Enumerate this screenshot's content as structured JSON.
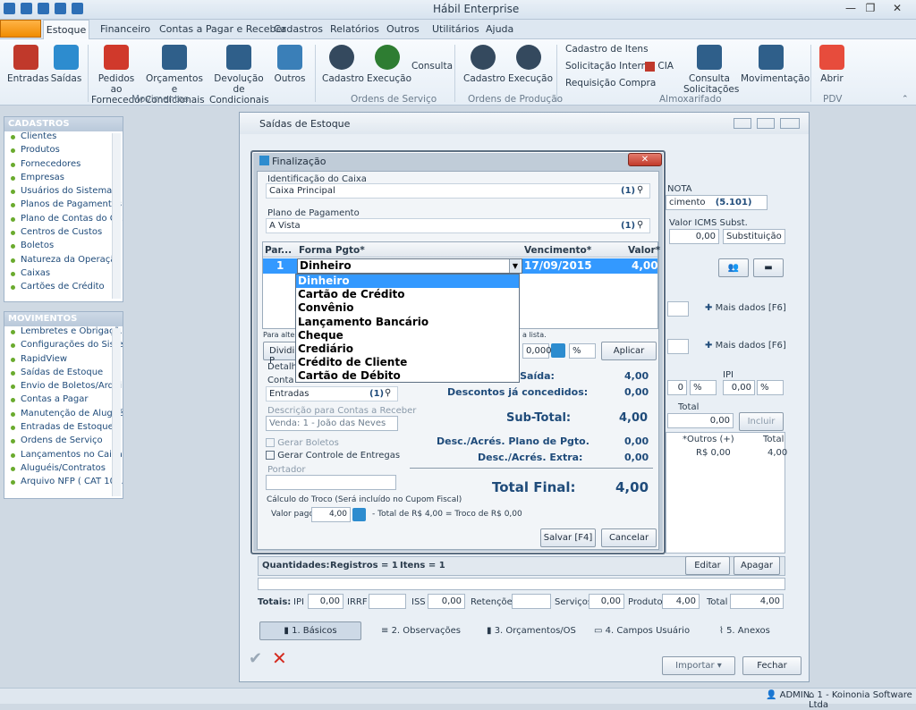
{
  "app": {
    "title": "Hábil Enterprise"
  },
  "menu": {
    "tabs": [
      "Estoque",
      "Financeiro",
      "Contas a Pagar e Receber",
      "Cadastros",
      "Relatórios",
      "Outros",
      "Utilitários",
      "Ajuda"
    ]
  },
  "ribbon": {
    "buttons": [
      {
        "label": "Entradas"
      },
      {
        "label": "Saídas"
      },
      {
        "label": "Pedidos ao\nFornecedor"
      },
      {
        "label": "Orçamentos e\nCondicionais"
      },
      {
        "label": "Devolução de\nCondicionais"
      },
      {
        "label": "Outros"
      },
      {
        "label": "Cadastro"
      },
      {
        "label": "Execução"
      },
      {
        "label": "Consulta"
      },
      {
        "label": "Cadastro"
      },
      {
        "label": "Execução"
      },
      {
        "label": "Cadastro de Itens"
      },
      {
        "label": "Solicitação Interna"
      },
      {
        "label": "Requisição Compra"
      },
      {
        "label": "CIA"
      },
      {
        "label": "Consulta\nSolicitações"
      },
      {
        "label": "Movimentação"
      },
      {
        "label": "Abrir"
      }
    ],
    "groups": [
      "Movimentos",
      "Ordens de Serviço",
      "Ordens de Produção",
      "Almoxarifado",
      "PDV"
    ]
  },
  "sidebar": {
    "cadastros_title": "CADASTROS",
    "cadastros": [
      "Clientes",
      "Produtos",
      "Fornecedores",
      "Empresas",
      "Usuários do Sistema",
      "Planos de Pagamentos",
      "Plano de Contas do Ca...",
      "Centros de Custos",
      "Boletos",
      "Natureza da Operação",
      "Caixas",
      "Cartões de Crédito"
    ],
    "movimentos_title": "MOVIMENTOS",
    "movimentos": [
      "Lembretes e Obrigaçõ...",
      "Configurações do Siste...",
      "RapidView",
      "Saídas de Estoque",
      "Envio de Boletos/Arqui...",
      "Contas a Pagar",
      "Manutenção de Alugué...",
      "Entradas de Estoque",
      "Ordens de Serviço",
      "Lançamentos no Caixa",
      "Aluguéis/Contratos",
      "Arquivo NFP ( CAT 102..."
    ]
  },
  "saidas": {
    "title": "Saídas de Estoque",
    "nota_label": "NOTA",
    "natureza_value": "cimento",
    "natureza_code": "(5.101)",
    "icms_label": "Valor ICMS Subst.",
    "icms_value": "0,00",
    "subst_select": "Substituição",
    "mais_dados": "Mais dados [F6]",
    "ipi_label": "IPI",
    "ipi_value": "0,00",
    "pct": "%",
    "disc_value": "0",
    "total_label": "Total",
    "total_value": "0,00",
    "incluir": "Incluir",
    "outros_col": "*Outros (+)",
    "total_col": "Total",
    "row_outros": "R$ 0,00",
    "row_total": "4,00",
    "quantidades": "Quantidades:",
    "registros": "Registros = 1",
    "itens": "Itens = 1",
    "editar": "Editar",
    "apagar": "Apagar",
    "totais": {
      "label": "Totais:",
      "ipi_label": "IPI",
      "ipi": "0,00",
      "irrf_label": "IRRF",
      "iss_label": "ISS",
      "iss": "0,00",
      "ret_label": "Retenções",
      "serv_label": "Serviços",
      "serv": "0,00",
      "prod_label": "Produtos",
      "prod": "4,00",
      "total_label": "Total",
      "total": "4,00"
    },
    "tabs": [
      "1. Básicos",
      "2. Observações",
      "3. Orçamentos/OS",
      "4. Campos Usuário",
      "5. Anexos"
    ],
    "importar": "Importar",
    "fechar": "Fechar"
  },
  "dialog": {
    "title": "Finalização",
    "caixa_label": "Identificação do Caixa",
    "caixa_value": "Caixa Principal",
    "caixa_code": "(1)",
    "plano_label": "Plano de Pagamento",
    "plano_value": "A Vista",
    "plano_code": "(1)",
    "grid_headers": [
      "Par...",
      "Forma Pgto*",
      "Vencimento*",
      "Valor*"
    ],
    "grid_row": {
      "par": "1",
      "forma": "Dinheiro",
      "venc": "17/09/2015",
      "valor": "4,00"
    },
    "dropdown": [
      "Dinheiro",
      "Cartão de Crédito",
      "Convênio",
      "Lançamento Bancário",
      "Cheque",
      "Crediário",
      "Crédito de Cliente",
      "Cartão de Débito"
    ],
    "hint_left": "Para alterar",
    "hint_right": "a lista.",
    "dividir": "Dividir P",
    "rate_value": "0,0000",
    "pct": "%",
    "aplicar": "Aplicar",
    "detalhes": "Detalhes",
    "conta_label": "Conta ca",
    "conta_value": "Entradas",
    "conta_code": "(1)",
    "descricao_placeholder": "Descrição para Contas a Receber",
    "descricao_value": "Venda: 1 - João das Neves",
    "gerar_boletos": "Gerar Boletos",
    "gerar_entregas": "Gerar Controle de Entregas",
    "portador": "Portador",
    "total_saida_label": "da Saída:",
    "total_saida": "4,00",
    "desc_conc_label": "Descontos já concedidos:",
    "desc_conc": "0,00",
    "subtotal_label": "Sub-Total:",
    "subtotal": "4,00",
    "desc_plano_label": "Desc./Acrés. Plano de Pgto.",
    "desc_plano": "0,00",
    "desc_extra_label": "Desc./Acrés. Extra:",
    "desc_extra": "0,00",
    "total_final_label": "Total Final:",
    "total_final": "4,00",
    "troco_label": "Cálculo do Troco (Será incluído no Cupom Fiscal)",
    "valor_pago_label": "Valor pago",
    "valor_pago": "4,00",
    "troco_text": "- Total de R$ 4,00 = Troco de R$ 0,00",
    "salvar": "Salvar [F4]",
    "cancelar": "Cancelar"
  },
  "status": {
    "user": "ADMIN",
    "company": "1 - Koinonia Software Ltda"
  },
  "colors": {
    "accent": "#1f4b7a",
    "selection": "#3399ff",
    "highlight_row": "#3399ff"
  }
}
